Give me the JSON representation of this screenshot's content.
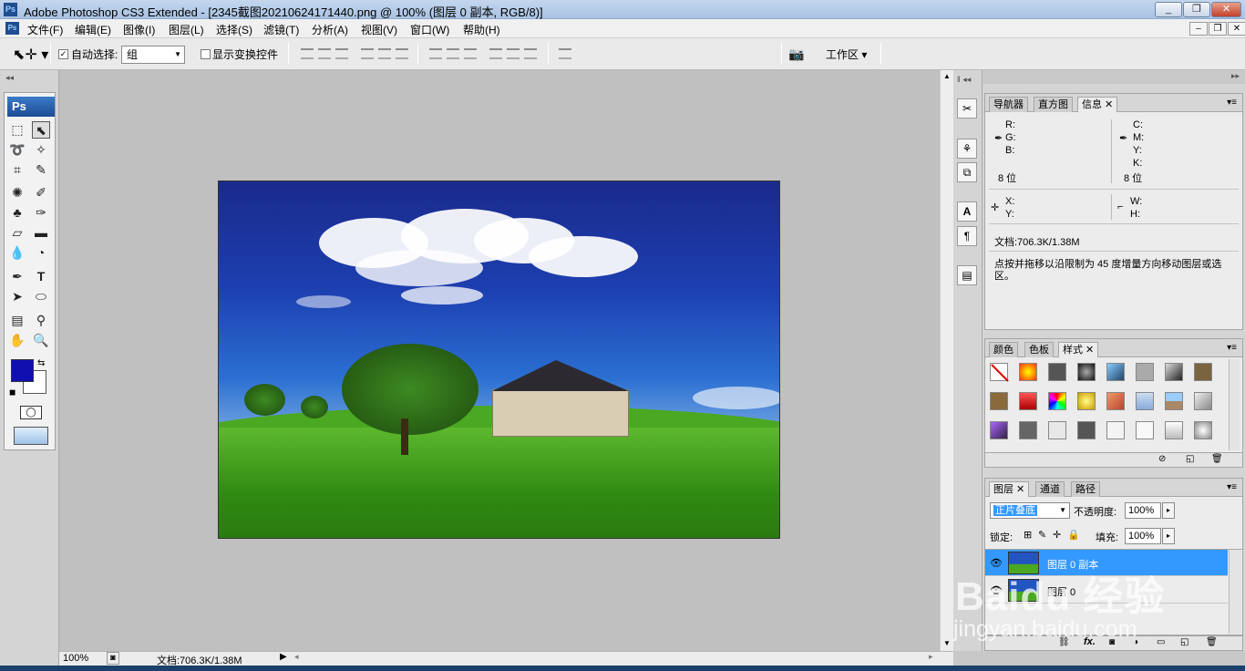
{
  "window": {
    "title": "Adobe Photoshop CS3 Extended - [2345截图20210624171440.png @ 100% (图层 0 副本, RGB/8)]",
    "logo_text": "Ps",
    "buttons": [
      "_",
      "❐",
      "✕"
    ]
  },
  "menu": {
    "items": [
      "文件(F)",
      "编辑(E)",
      "图像(I)",
      "图层(L)",
      "选择(S)",
      "滤镜(T)",
      "分析(A)",
      "视图(V)",
      "窗口(W)",
      "帮助(H)"
    ],
    "doc_buttons": [
      "–",
      "❐",
      "✕"
    ]
  },
  "options": {
    "auto_select_label": "自动选择:",
    "auto_select_checked": true,
    "auto_select_value": "组",
    "show_transform_label": "显示变换控件",
    "show_transform_checked": false,
    "workspace_label": "工作区"
  },
  "tools": {
    "badge": "Ps",
    "foreground_color": "#1010b0",
    "background_color": "#ffffff"
  },
  "status": {
    "zoom": "100%",
    "doc_info": "文档:706.3K/1.38M"
  },
  "info_panel": {
    "tabs": [
      "导航器",
      "直方图",
      "信息"
    ],
    "active_tab": "信息",
    "rgb_labels": [
      "R:",
      "G:",
      "B:"
    ],
    "cmyk_labels": [
      "C:",
      "M:",
      "Y:",
      "K:"
    ],
    "bits_left": "8 位",
    "bits_right": "8 位",
    "xy_labels": [
      "X:",
      "Y:"
    ],
    "wh_labels": [
      "W:",
      "H:"
    ],
    "doc_info": "文档:706.3K/1.38M",
    "hint": "点按并拖移以沿限制为 45 度增量方向移动图层或选区。"
  },
  "styles_panel": {
    "tabs": [
      "颜色",
      "色板",
      "样式"
    ],
    "active_tab": "样式"
  },
  "layers_panel": {
    "tabs": [
      "图层",
      "通道",
      "路径"
    ],
    "active_tab": "图层",
    "blend_mode": "正片叠底",
    "opacity_label": "不透明度:",
    "opacity_value": "100%",
    "lock_label": "锁定:",
    "fill_label": "填充:",
    "fill_value": "100%",
    "layers": [
      {
        "name": "图层 0 副本",
        "selected": true
      },
      {
        "name": "图层 0",
        "selected": false
      }
    ]
  },
  "watermark": {
    "text": "Baidu 经验",
    "url": "jingyan.baidu.com"
  }
}
